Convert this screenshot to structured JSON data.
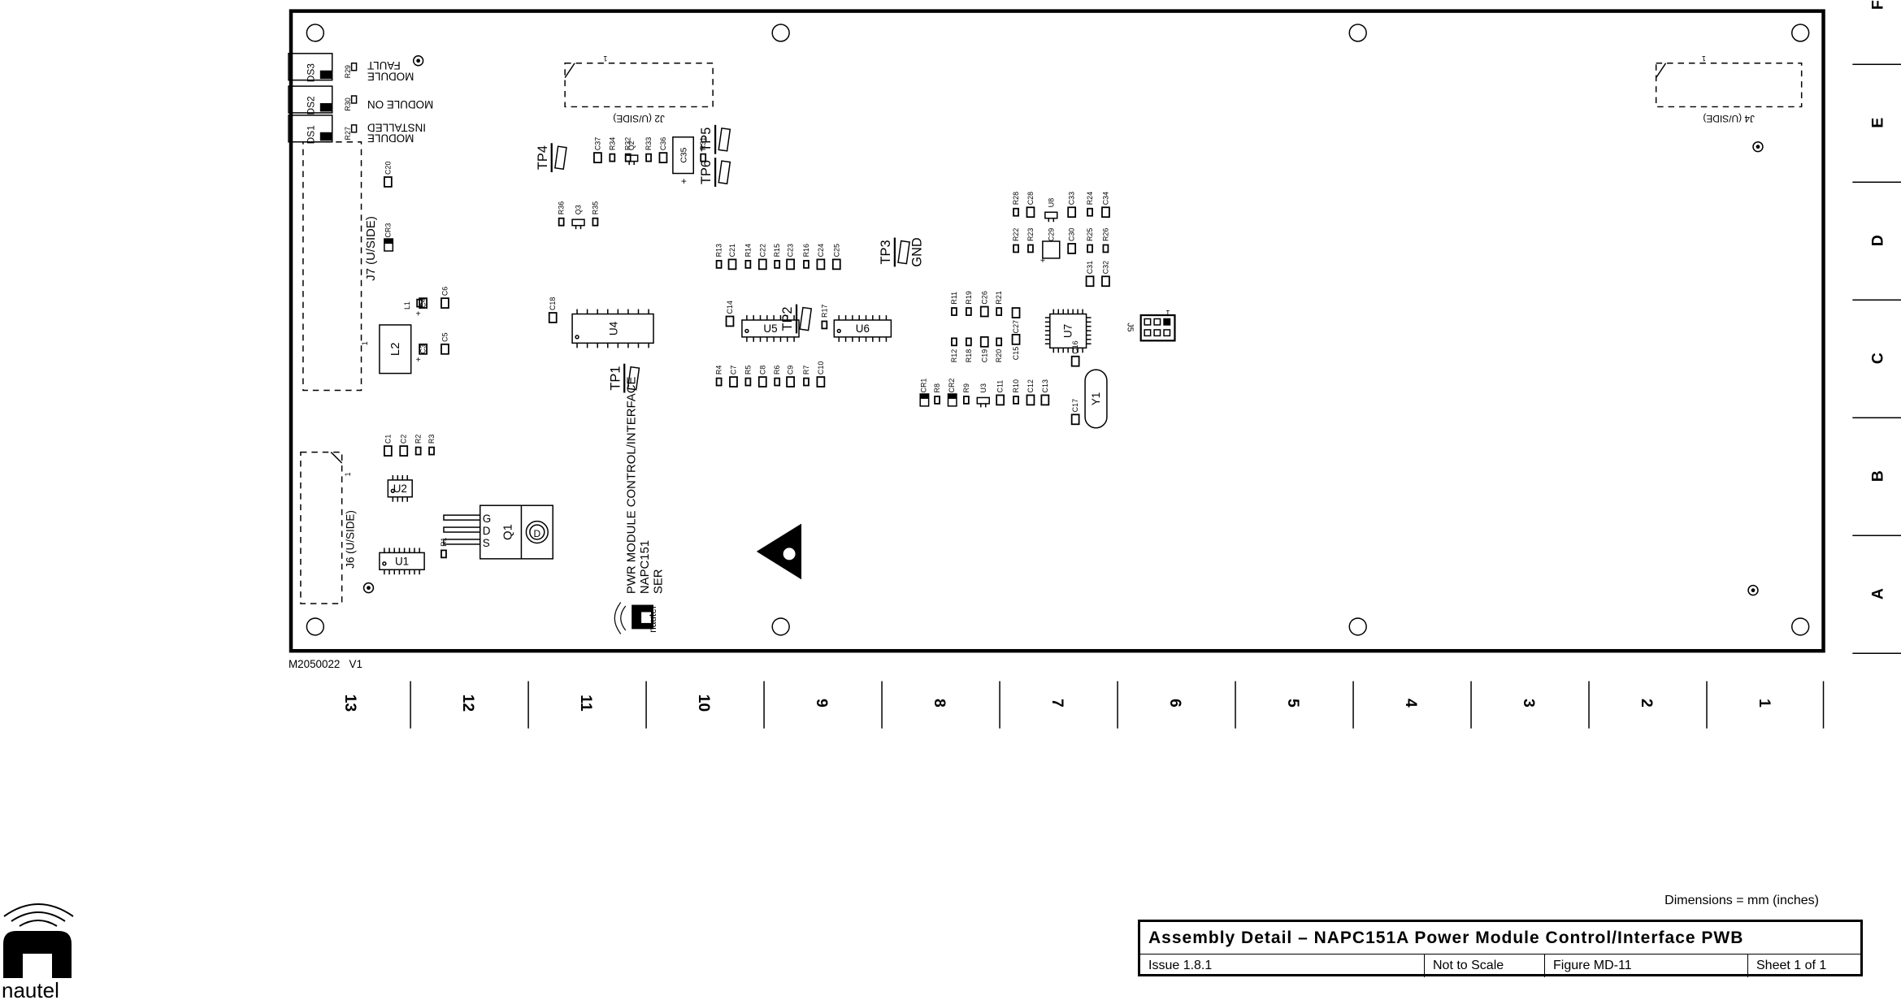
{
  "drawing": {
    "part_number": "M2050022   V1",
    "board_marking": [
      "PWR MODULE CONTROL/INTERFACE",
      "NAPC151",
      "SER"
    ],
    "logo_text": "nautel",
    "dimensions_note": "Dimensions = mm (inches)"
  },
  "title_block": {
    "title": "Assembly Detail – NAPC151A Power Module Control/Interface PWB",
    "issue": "Issue 1.8.1",
    "scale": "Not to Scale",
    "figure": "Figure MD-11",
    "sheet": "Sheet 1 of 1"
  },
  "grid": {
    "columns": [
      "13",
      "12",
      "11",
      "10",
      "9",
      "8",
      "7",
      "6",
      "5",
      "4",
      "3",
      "2",
      "1"
    ],
    "rows": [
      "F",
      "E",
      "D",
      "C",
      "B",
      "A"
    ]
  },
  "leds": [
    {
      "ref": "DS1",
      "resistor": "R27",
      "label_lines": [
        "MODULE",
        "INSTALLED"
      ]
    },
    {
      "ref": "DS2",
      "resistor": "R30",
      "label_lines": [
        "MODULE ON"
      ]
    },
    {
      "ref": "DS3",
      "resistor": "R29",
      "label_lines": [
        "MODULE",
        "FAULT"
      ]
    }
  ],
  "connectors": [
    {
      "ref": "J2 (U/SIDE)",
      "pin1": "1"
    },
    {
      "ref": "J4 (U/SIDE)",
      "pin1": "1"
    },
    {
      "ref": "J6 (U/SIDE)",
      "pin1": "1"
    },
    {
      "ref": "J7 (U/SIDE)",
      "pin1": "1"
    },
    {
      "ref": "J5",
      "pin1": "1"
    }
  ],
  "ics": [
    "U1",
    "U2",
    "U4",
    "U5",
    "U6",
    "U7",
    "L2",
    "Y1",
    "C35"
  ],
  "transistor_q1": {
    "ref": "Q1",
    "pins": [
      "G",
      "D",
      "S"
    ],
    "tab": "D"
  },
  "test_points": [
    "TP1",
    "TP2",
    "TP3",
    "TP4",
    "TP5",
    "TP6"
  ],
  "tp3_note": "GND",
  "components": [
    "C37",
    "R34",
    "R32",
    "Q2",
    "R33",
    "C36",
    "R31",
    "R36",
    "Q3",
    "R35",
    "C20",
    "CR3",
    "L1",
    "C4",
    "C6",
    "C3",
    "C5",
    "C18",
    "R13",
    "C21",
    "R14",
    "C22",
    "R15",
    "C23",
    "R16",
    "C24",
    "C25",
    "C14",
    "R17",
    "R4",
    "C7",
    "R5",
    "C8",
    "R6",
    "C9",
    "R7",
    "C10",
    "R28",
    "C28",
    "U8",
    "C33",
    "R24",
    "C34",
    "R22",
    "R23",
    "C29",
    "C30",
    "R25",
    "R26",
    "C31",
    "C32",
    "R11",
    "R19",
    "C26",
    "R21",
    "C27",
    "R12",
    "R18",
    "C19",
    "R20",
    "C15",
    "C16",
    "C17",
    "CR1",
    "R8",
    "CR2",
    "R9",
    "U3",
    "C11",
    "R10",
    "C12",
    "C13",
    "C1",
    "C2",
    "R2",
    "R3",
    "R1"
  ]
}
